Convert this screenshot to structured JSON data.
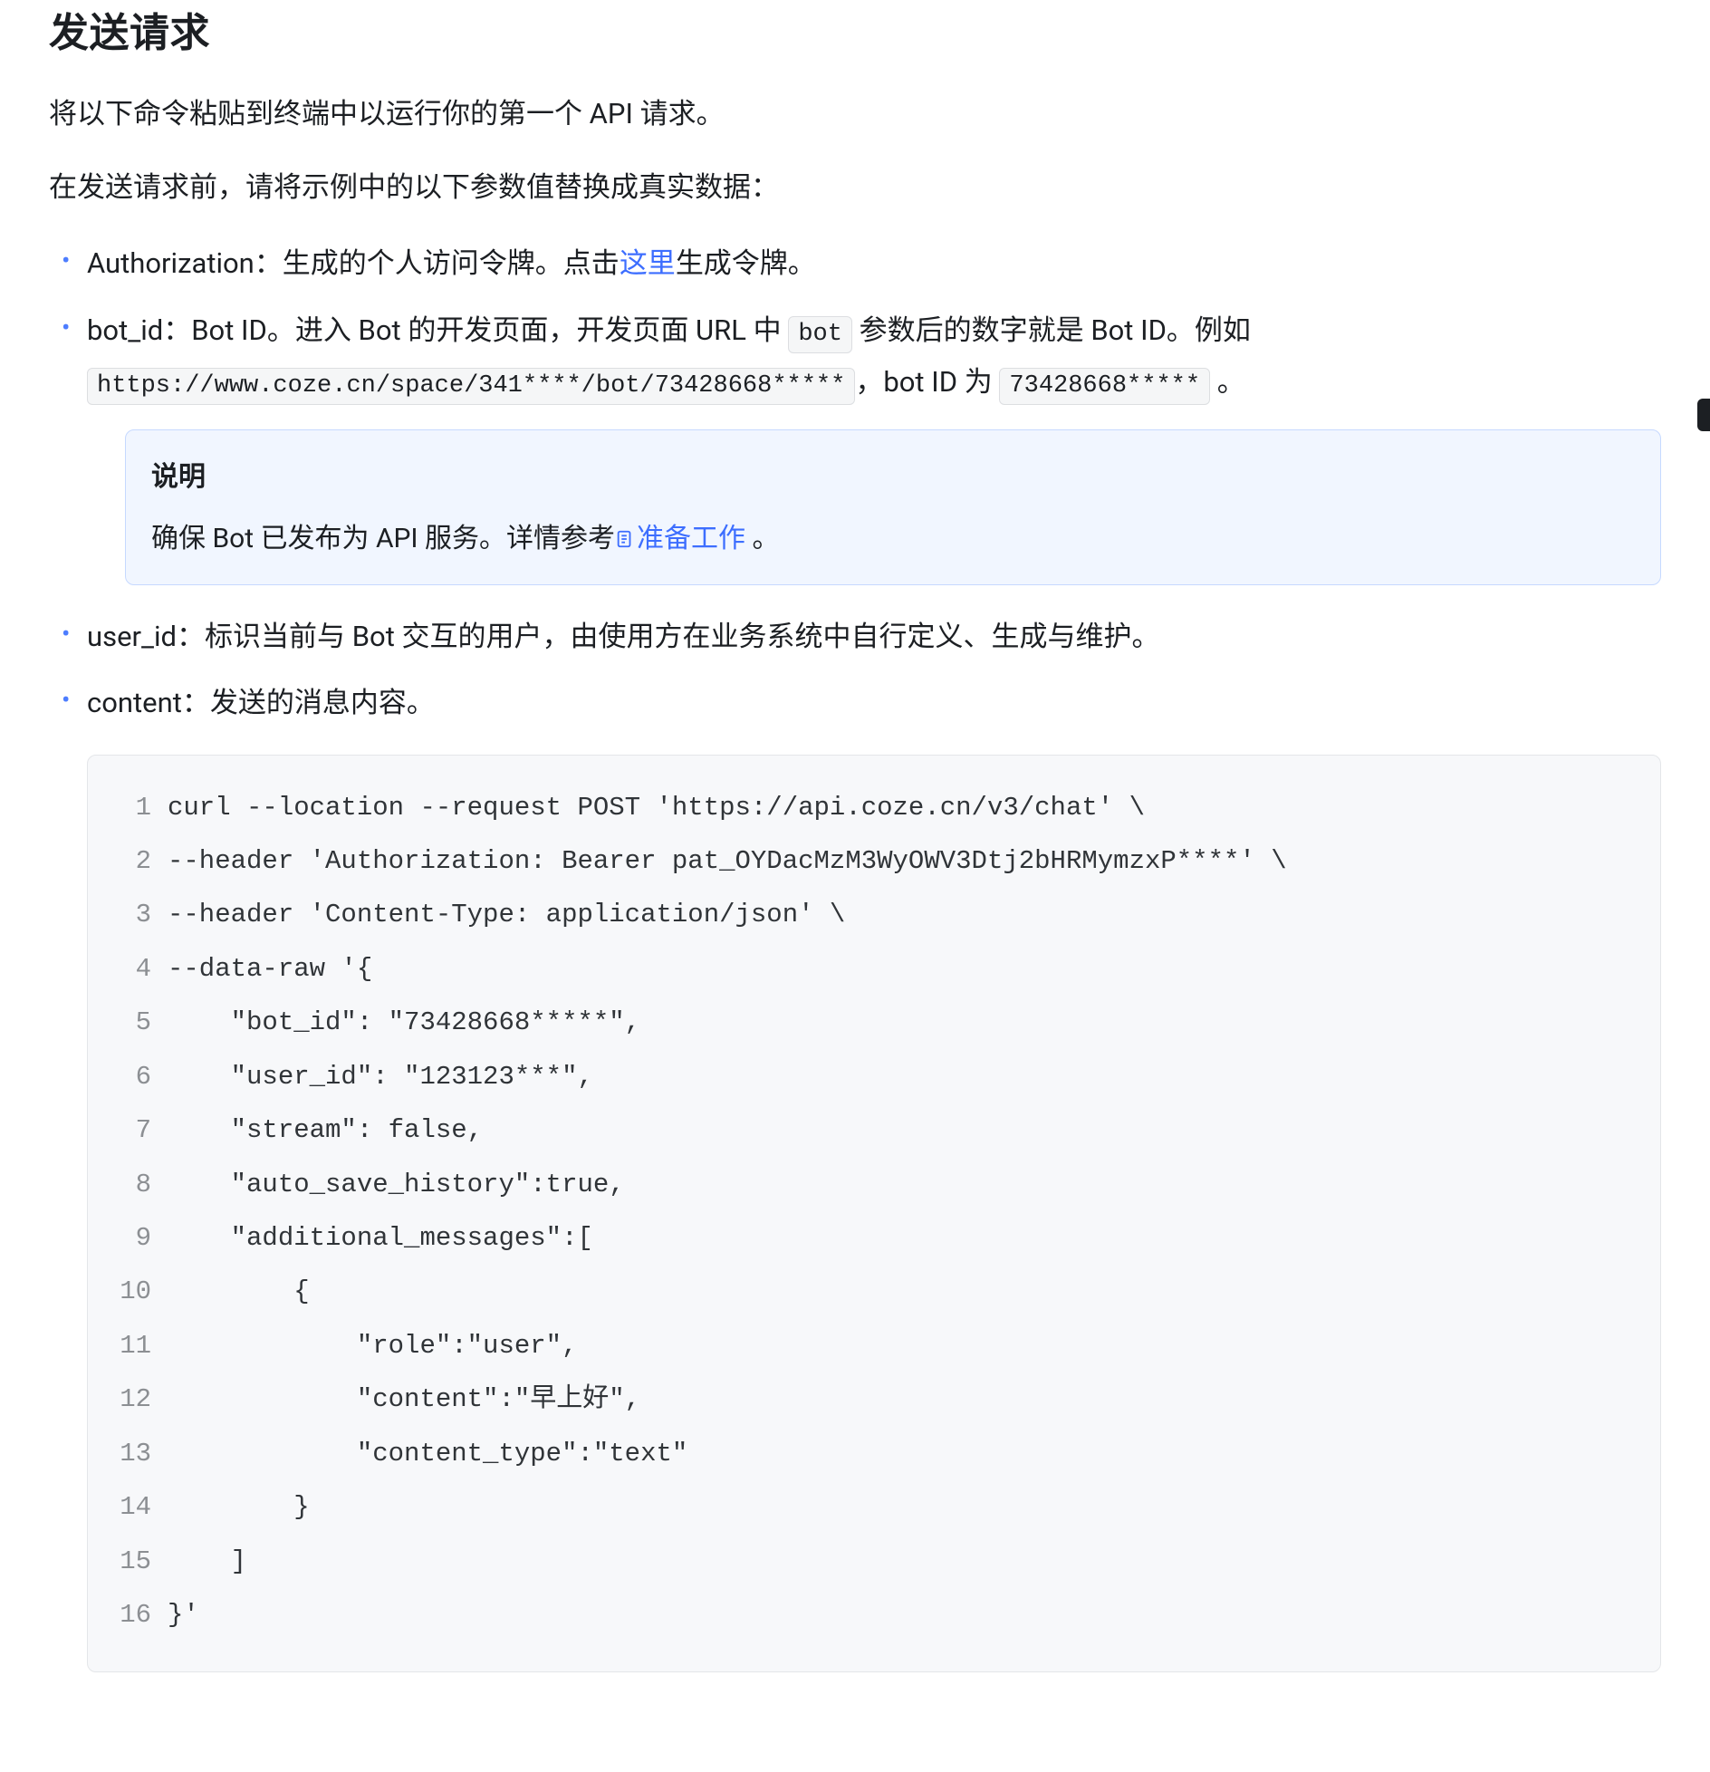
{
  "heading": "发送请求",
  "intro1": "将以下命令粘贴到终端中以运行你的第一个 API 请求。",
  "intro2": "在发送请求前，请将示例中的以下参数值替换成真实数据：",
  "bullet_auth_prefix": "Authorization：生成的个人访问令牌。点击",
  "bullet_auth_link": "这里",
  "bullet_auth_suffix": "生成令牌。",
  "bullet_botid_prefix": "bot_id：Bot ID。进入 Bot 的开发页面，开发页面 URL 中 ",
  "bullet_botid_code1": "bot",
  "bullet_botid_mid": " 参数后的数字就是 Bot ID。例如 ",
  "bullet_botid_code2": "https://www.coze.cn/space/341****/bot/73428668*****",
  "bullet_botid_mid2": "，bot ID 为 ",
  "bullet_botid_code3": "73428668*****",
  "bullet_botid_tail": " 。",
  "note_title": "说明",
  "note_body_prefix": "确保 Bot 已发布为 API 服务。详情参考",
  "note_body_link": "准备工作",
  "note_body_suffix": " 。",
  "bullet_userid": "user_id：标识当前与 Bot 交互的用户，由使用方在业务系统中自行定义、生成与维护。",
  "bullet_content": "content：发送的消息内容。",
  "code": {
    "lines": [
      "curl --location --request POST 'https://api.coze.cn/v3/chat' \\",
      "--header 'Authorization: Bearer pat_OYDacMzM3WyOWV3Dtj2bHRMymzxP****' \\",
      "--header 'Content-Type: application/json' \\",
      "--data-raw '{",
      "    \"bot_id\": \"73428668*****\",",
      "    \"user_id\": \"123123***\",",
      "    \"stream\": false,",
      "    \"auto_save_history\":true,",
      "    \"additional_messages\":[",
      "        {",
      "            \"role\":\"user\",",
      "            \"content\":\"早上好\",",
      "            \"content_type\":\"text\"",
      "        }",
      "    ]",
      "}'"
    ]
  }
}
